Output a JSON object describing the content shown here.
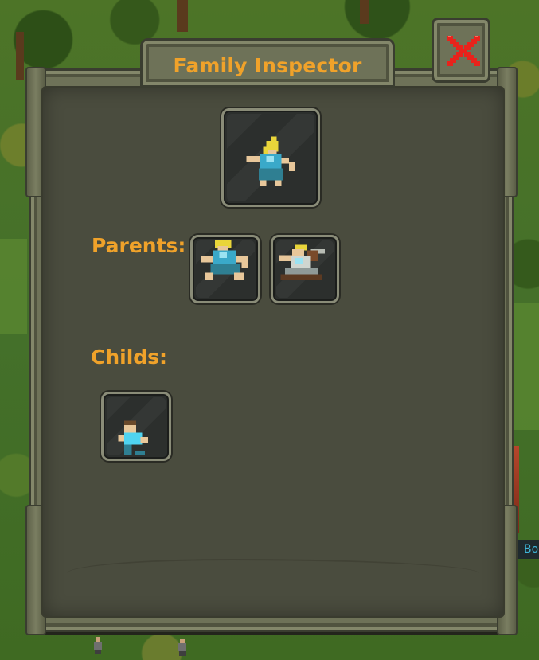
{
  "window": {
    "title": "Family Inspector"
  },
  "sections": {
    "parents_label": "Parents:",
    "childs_label": "Childs:"
  },
  "inspected_unit": {
    "icon": "female-villager-sprite"
  },
  "parents": [
    {
      "icon": "female-villager-sprite"
    },
    {
      "icon": "male-villager-sprite"
    }
  ],
  "childs": [
    {
      "icon": "child-villager-sprite"
    }
  ],
  "close_button": {
    "icon": "close-x-icon",
    "color": "#e8231c"
  },
  "colors": {
    "title": "#f0a22a",
    "panel": "#4a4c3e",
    "frame": "#6e7258",
    "slot": "#2c2f2d"
  },
  "map_overlay": {
    "side_label": "Bo"
  }
}
